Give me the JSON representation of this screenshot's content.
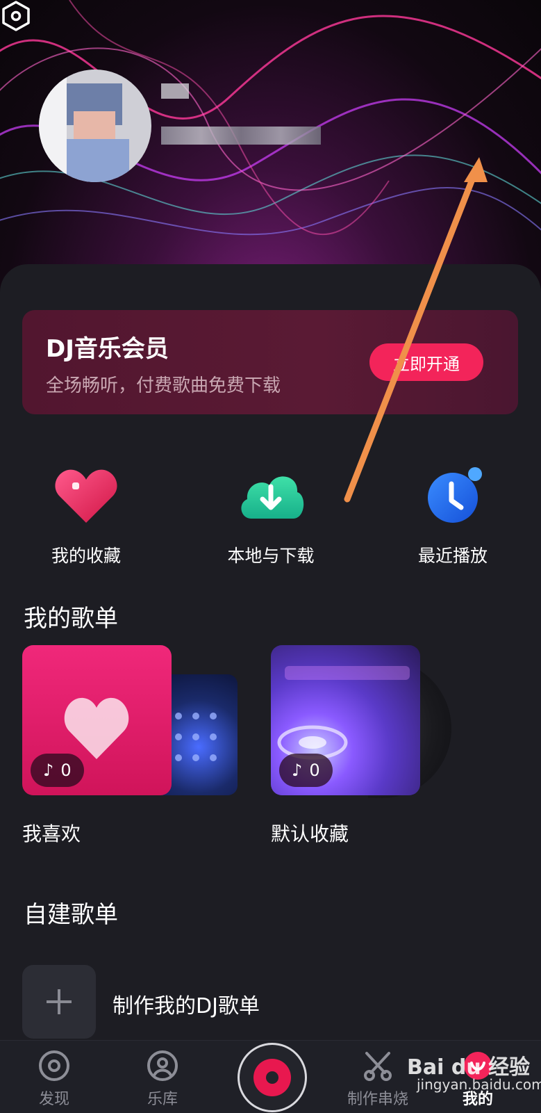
{
  "vip": {
    "title": "DJ音乐会员",
    "subtitle": "全场畅听，付费歌曲免费下载",
    "button": "立即开通"
  },
  "quick_actions": [
    {
      "label": "我的收藏",
      "icon": "heart-icon"
    },
    {
      "label": "本地与下载",
      "icon": "cloud-download-icon"
    },
    {
      "label": "最近播放",
      "icon": "clock-icon"
    }
  ],
  "my_playlists": {
    "title": "我的歌单",
    "items": [
      {
        "name": "我喜欢",
        "count": "0"
      },
      {
        "name": "默认收藏",
        "count": "0"
      }
    ]
  },
  "custom_playlists": {
    "title": "自建歌单",
    "create_label": "制作我的DJ歌单"
  },
  "tabbar": {
    "tabs": [
      {
        "label": "发现",
        "icon": "discover-icon"
      },
      {
        "label": "乐库",
        "icon": "library-icon"
      },
      {
        "label": "制作串烧",
        "icon": "mix-icon"
      },
      {
        "label": "我的",
        "icon": "profile-icon"
      }
    ]
  },
  "watermark": {
    "brand": "Bai du 经验",
    "url": "jingyan.baidu.com"
  },
  "colors": {
    "accent": "#f3245a",
    "background": "#1d1d23",
    "annotation_arrow": "#f0904a"
  }
}
